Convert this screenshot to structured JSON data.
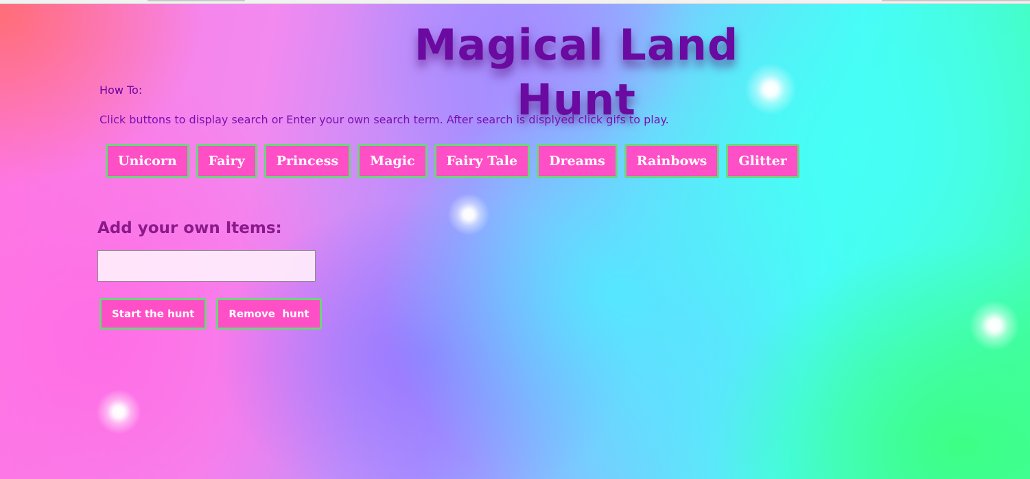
{
  "page": {
    "title": "Magical Land Hunt",
    "howto_label": "How To:",
    "howto_text": "Click buttons to display search or Enter your own search term. After search is displyed click gifs to play."
  },
  "topics": [
    {
      "label": "Unicorn"
    },
    {
      "label": "Fairy"
    },
    {
      "label": "Princess"
    },
    {
      "label": "Magic"
    },
    {
      "label": "Fairy Tale"
    },
    {
      "label": "Dreams"
    },
    {
      "label": "Rainbows"
    },
    {
      "label": "Glitter"
    }
  ],
  "add_section": {
    "heading_part1": "Add ",
    "heading_part2": "your own",
    "heading_part3": " Items:",
    "input_value": "",
    "input_placeholder": ""
  },
  "actions": {
    "start_label": "Start the hunt",
    "remove_label": "Remove  hunt"
  },
  "colors": {
    "button_bg": "#ff4fc7",
    "button_border": "#6fd47e",
    "title_color": "#6a0aa0"
  }
}
